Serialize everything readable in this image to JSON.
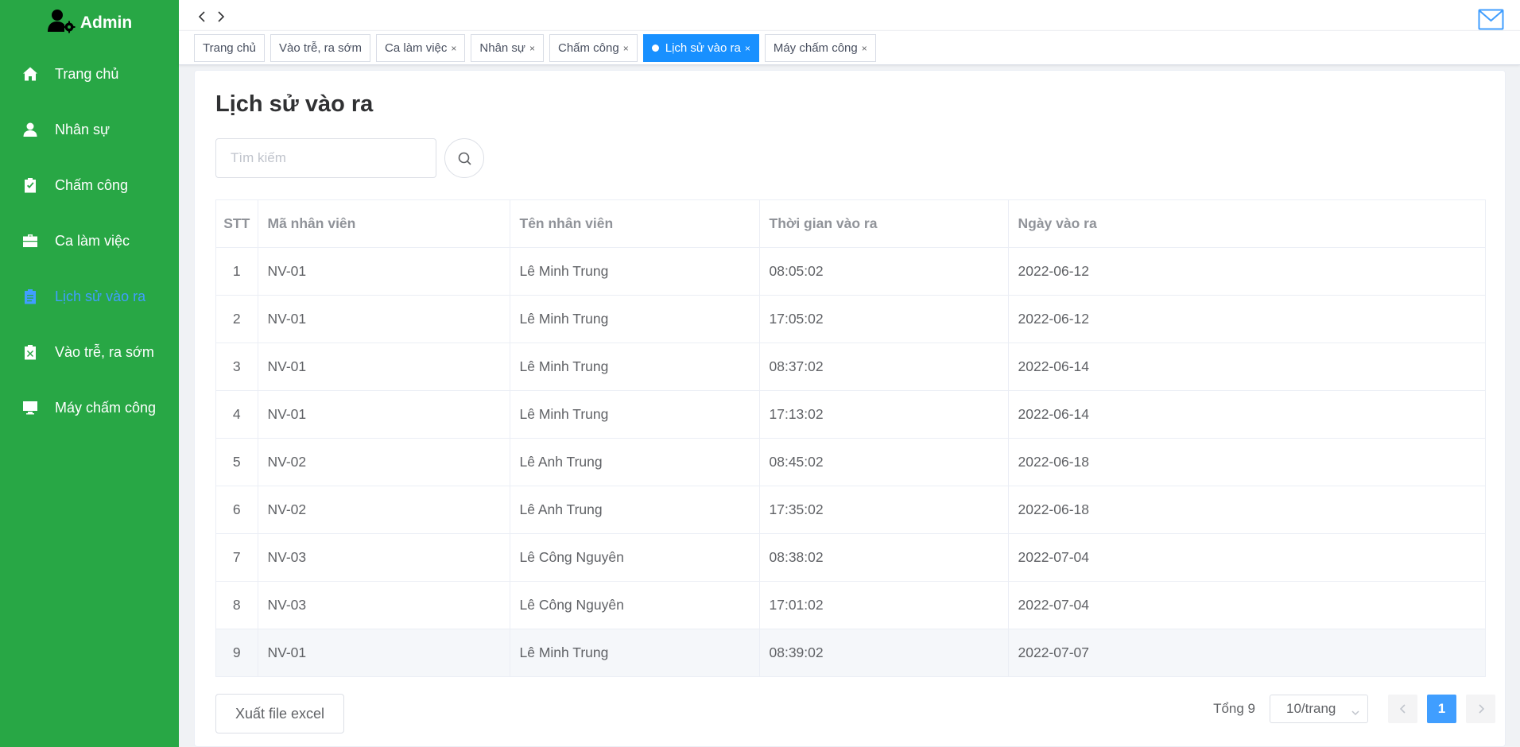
{
  "brand": {
    "title": "Admin"
  },
  "sidebar": {
    "items": [
      {
        "label": "Trang chủ",
        "icon": "home-icon",
        "active": false
      },
      {
        "label": "Nhân sự",
        "icon": "user-icon",
        "active": false
      },
      {
        "label": "Chấm công",
        "icon": "clipboard-check-icon",
        "active": false
      },
      {
        "label": "Ca làm việc",
        "icon": "briefcase-icon",
        "active": false
      },
      {
        "label": "Lịch sử vào ra",
        "icon": "clipboard-list-icon",
        "active": true
      },
      {
        "label": "Vào trễ, ra sớm",
        "icon": "clipboard-x-icon",
        "active": false
      },
      {
        "label": "Máy chấm công",
        "icon": "monitor-icon",
        "active": false
      }
    ]
  },
  "tags": [
    {
      "label": "Trang chủ",
      "closable": false,
      "active": false
    },
    {
      "label": "Vào trễ, ra sớm",
      "closable": false,
      "active": false
    },
    {
      "label": "Ca làm việc",
      "closable": true,
      "active": false
    },
    {
      "label": "Nhân sự",
      "closable": true,
      "active": false
    },
    {
      "label": "Chấm công",
      "closable": true,
      "active": false
    },
    {
      "label": "Lịch sử vào ra",
      "closable": true,
      "active": true
    },
    {
      "label": "Máy chấm công",
      "closable": true,
      "active": false
    }
  ],
  "tag_close_glyph": "×",
  "page": {
    "title": "Lịch sử vào ra",
    "search_placeholder": "Tìm kiếm"
  },
  "table": {
    "columns": [
      "STT",
      "Mã nhân viên",
      "Tên nhân viên",
      "Thời gian vào ra",
      "Ngày vào ra"
    ],
    "rows": [
      [
        "1",
        "NV-01",
        "Lê Minh Trung",
        "08:05:02",
        "2022-06-12"
      ],
      [
        "2",
        "NV-01",
        "Lê Minh Trung",
        "17:05:02",
        "2022-06-12"
      ],
      [
        "3",
        "NV-01",
        "Lê Minh Trung",
        "08:37:02",
        "2022-06-14"
      ],
      [
        "4",
        "NV-01",
        "Lê Minh Trung",
        "17:13:02",
        "2022-06-14"
      ],
      [
        "5",
        "NV-02",
        "Lê Anh Trung",
        "08:45:02",
        "2022-06-18"
      ],
      [
        "6",
        "NV-02",
        "Lê Anh Trung",
        "17:35:02",
        "2022-06-18"
      ],
      [
        "7",
        "NV-03",
        "Lê Công Nguyên",
        "08:38:02",
        "2022-07-04"
      ],
      [
        "8",
        "NV-03",
        "Lê Công Nguyên",
        "17:01:02",
        "2022-07-04"
      ],
      [
        "9",
        "NV-01",
        "Lê Minh Trung",
        "08:39:02",
        "2022-07-07"
      ]
    ]
  },
  "footer": {
    "export_label": "Xuất file excel",
    "total_label": "Tổng 9",
    "page_size": "10/trang",
    "current_page": "1"
  },
  "colors": {
    "sidebar_bg": "#28a745",
    "active_blue": "#409eff",
    "active_tag": "#1890ff"
  }
}
